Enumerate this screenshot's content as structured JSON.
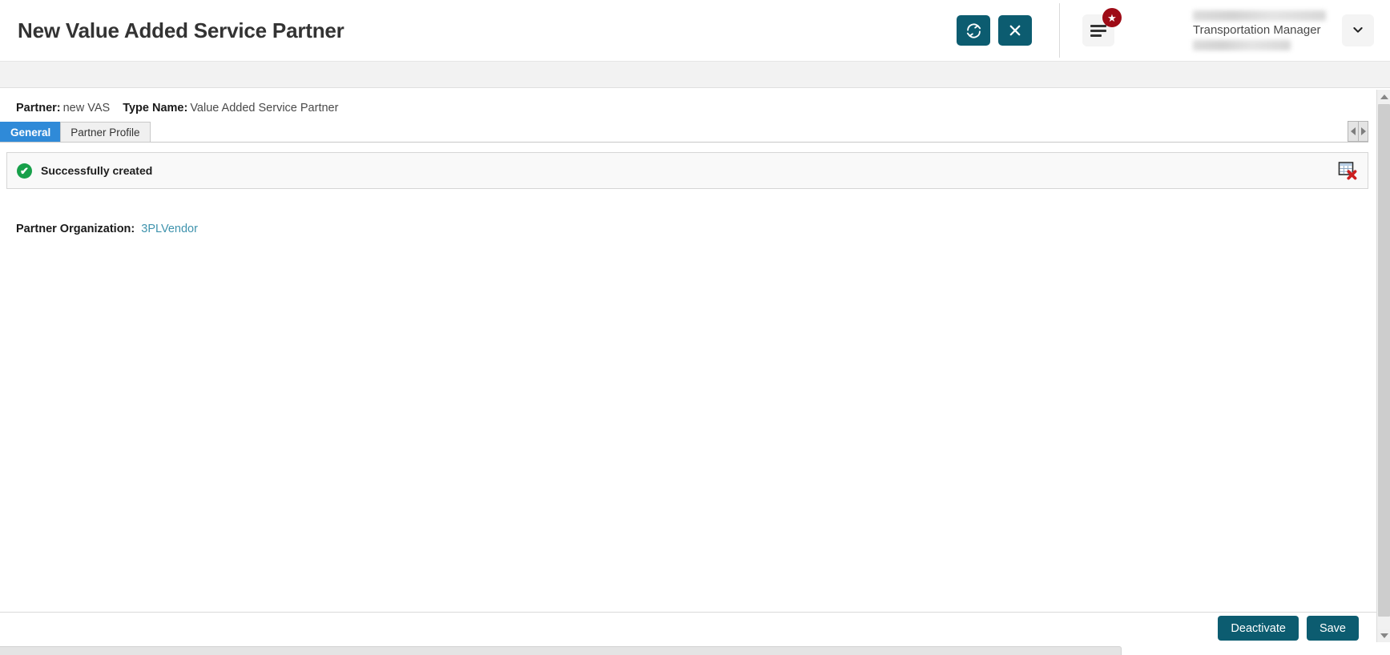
{
  "header": {
    "title": "New Value Added Service Partner",
    "refresh_icon": "refresh-icon",
    "close_icon": "close-icon",
    "menu_icon": "hamburger-menu-icon",
    "badge_icon": "star-badge-icon",
    "badge_glyph": "★",
    "user_role": "Transportation Manager",
    "chevron_icon": "chevron-down-icon",
    "chevron_glyph": "⌄"
  },
  "meta": {
    "partner_label": "Partner:",
    "partner_value": "new VAS",
    "type_label": "Type Name:",
    "type_value": "Value Added Service Partner"
  },
  "tabs": [
    {
      "label": "General",
      "active": true
    },
    {
      "label": "Partner Profile",
      "active": false
    }
  ],
  "tab_scroll": {
    "left_icon": "scroll-left-arrow-icon",
    "right_icon": "scroll-right-arrow-icon"
  },
  "banner": {
    "status_icon": "success-check-icon",
    "check_glyph": "✔",
    "message": "Successfully created",
    "action_icon": "delete-grid-icon"
  },
  "fields": [
    {
      "label": "Partner Organization:",
      "value": "3PLVendor",
      "is_link": true
    }
  ],
  "footer": {
    "deactivate_label": "Deactivate",
    "save_label": "Save"
  },
  "scrollbars": {
    "vertical_up_icon": "scroll-up-arrow-icon",
    "vertical_down_icon": "scroll-down-arrow-icon"
  },
  "colors": {
    "teal": "#0c5c70",
    "tab_active_blue": "#2f8ad8",
    "success_green": "#17a04a",
    "badge_red": "#9e0b16",
    "link_blue": "#3f93ad"
  }
}
